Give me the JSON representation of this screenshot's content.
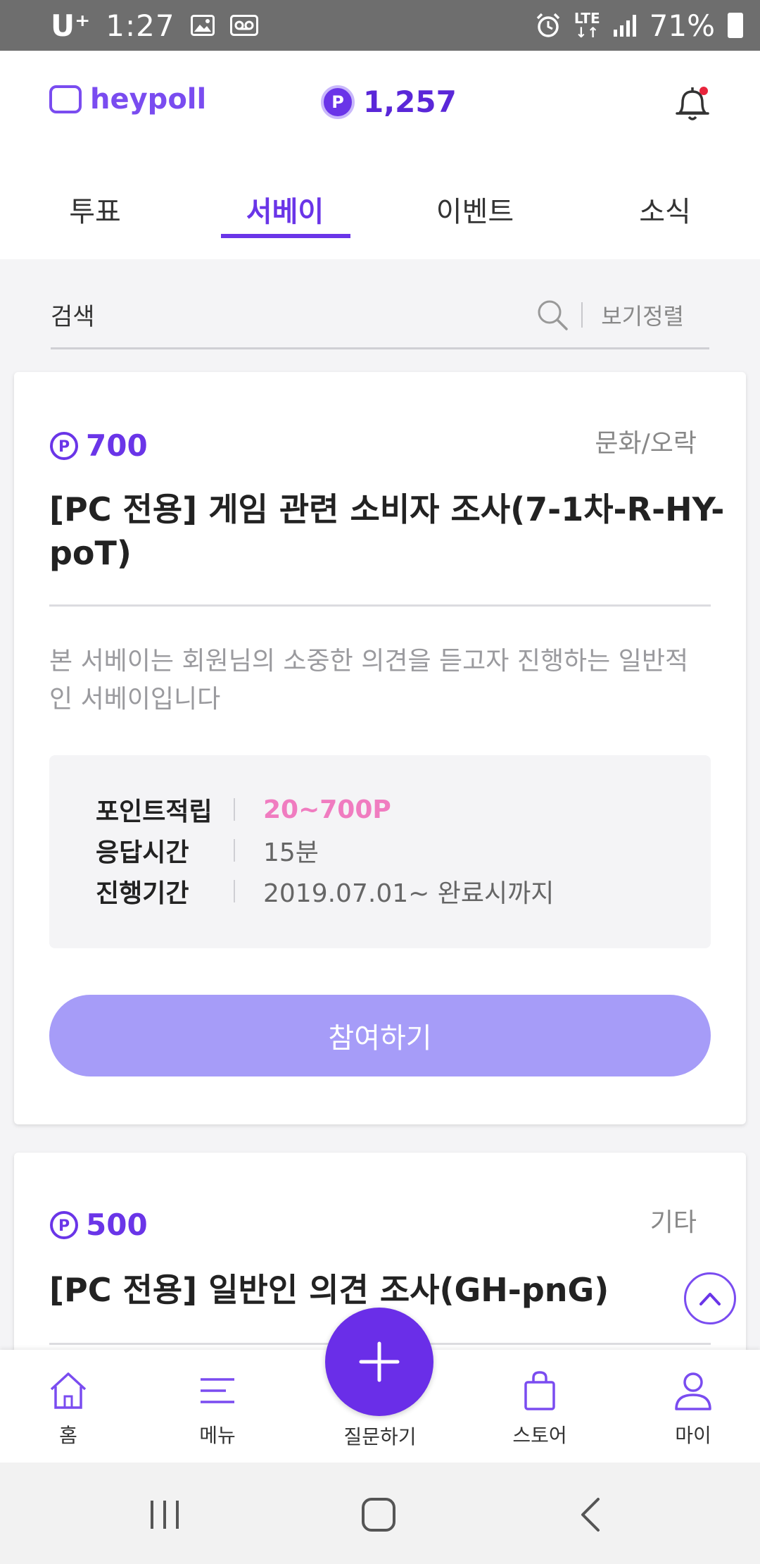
{
  "status_bar": {
    "carrier": "U⁺",
    "time": "1:27",
    "lte_top": "LTE",
    "lte_bottom": "↓↑",
    "battery": "71%"
  },
  "header": {
    "logo_text": "heypoll",
    "point_badge": "P",
    "points": "1,257"
  },
  "tabs": [
    "투표",
    "서베이",
    "이벤트",
    "소식"
  ],
  "active_tab": 1,
  "search": {
    "placeholder": "검색",
    "sort_label": "보기정렬"
  },
  "surveys": [
    {
      "points": "700",
      "category": "문화/오락",
      "title": "[PC 전용] 게임 관련 소비자 조사(7-1차-R-HY-poT)",
      "description": "본 서베이는 회원님의 소중한 의견을 듣고자 진행하는 일반적인 서베이입니다",
      "info": [
        {
          "label": "포인트적립",
          "value": "20~700P"
        },
        {
          "label": "응답시간",
          "value": "15분"
        },
        {
          "label": "진행기간",
          "value": "2019.07.01~ 완료시까지"
        }
      ],
      "button_label": "참여하기"
    },
    {
      "points": "500",
      "category": "기타",
      "title": "[PC 전용] 일반인 의견 조사(GH-pnG)"
    }
  ],
  "bottom_nav": {
    "home": "홈",
    "menu": "메뉴",
    "ask": "질문하기",
    "store": "스토어",
    "my": "마이"
  },
  "colors": {
    "brand": "#6a35e8",
    "button": "#a69cf8",
    "highlight": "#f07cc0"
  }
}
